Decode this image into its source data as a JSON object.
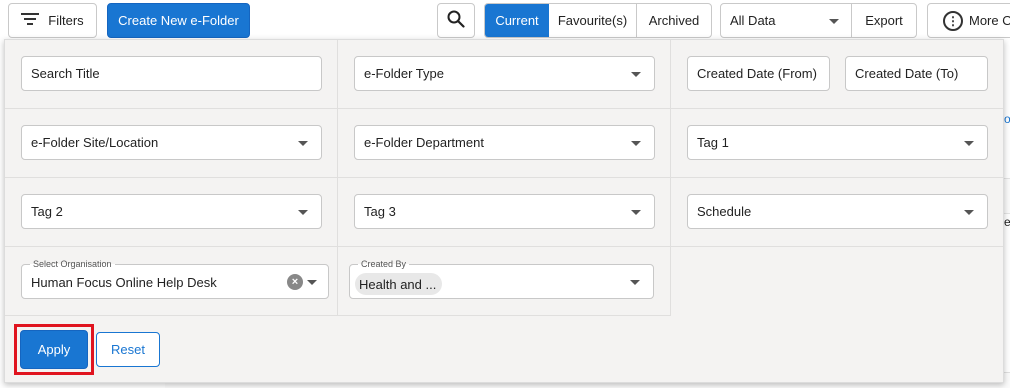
{
  "toolbar": {
    "filters_label": "Filters",
    "create_label": "Create New e-Folder",
    "tabs": [
      "Current",
      "Favourite(s)",
      "Archived"
    ],
    "data_select_value": "All Data",
    "export_label": "Export",
    "more_label": "More O"
  },
  "background": {
    "frag_1": "o",
    "frag_2": "e"
  },
  "filters": {
    "search_title": "Search Title",
    "folder_type": "e-Folder Type",
    "created_from": "Created Date (From)",
    "created_to": "Created Date (To)",
    "site_location": "e-Folder Site/Location",
    "department": "e-Folder Department",
    "tag1": "Tag 1",
    "tag2": "Tag 2",
    "tag3": "Tag 3",
    "schedule": "Schedule",
    "organisation_label": "Select Organisation",
    "organisation_value": "Human Focus Online Help Desk",
    "created_by_label": "Created By",
    "created_by_value": "Health and ...",
    "apply_label": "Apply",
    "reset_label": "Reset"
  },
  "colors": {
    "accent": "#1976d2",
    "highlight": "#e0141f",
    "panel_bg": "#f4f3f2"
  }
}
